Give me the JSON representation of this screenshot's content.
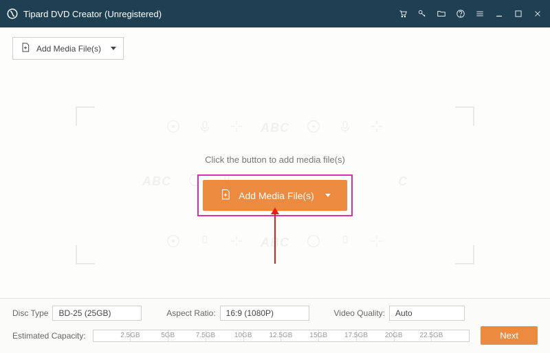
{
  "app": {
    "title": "Tipard DVD Creator (Unregistered)"
  },
  "toolbar": {
    "add_label": "Add Media File(s)"
  },
  "drop": {
    "hint": "Click the button to add media file(s)",
    "button_label": "Add Media File(s)",
    "faint_text": "ABC"
  },
  "footer": {
    "disc_type_label": "Disc Type",
    "disc_type_value": "BD-25 (25GB)",
    "aspect_label": "Aspect Ratio:",
    "aspect_value": "16:9 (1080P)",
    "quality_label": "Video Quality:",
    "quality_value": "Auto",
    "capacity_label": "Estimated Capacity:",
    "capacity_ticks": [
      "2.5GB",
      "5GB",
      "7.5GB",
      "10GB",
      "12.5GB",
      "15GB",
      "17.5GB",
      "20GB",
      "22.5GB"
    ],
    "next_label": "Next"
  },
  "colors": {
    "titlebar": "#1f4053",
    "accent": "#ec8a3f",
    "annotation": "#d333a8",
    "arrow": "#e02020"
  }
}
